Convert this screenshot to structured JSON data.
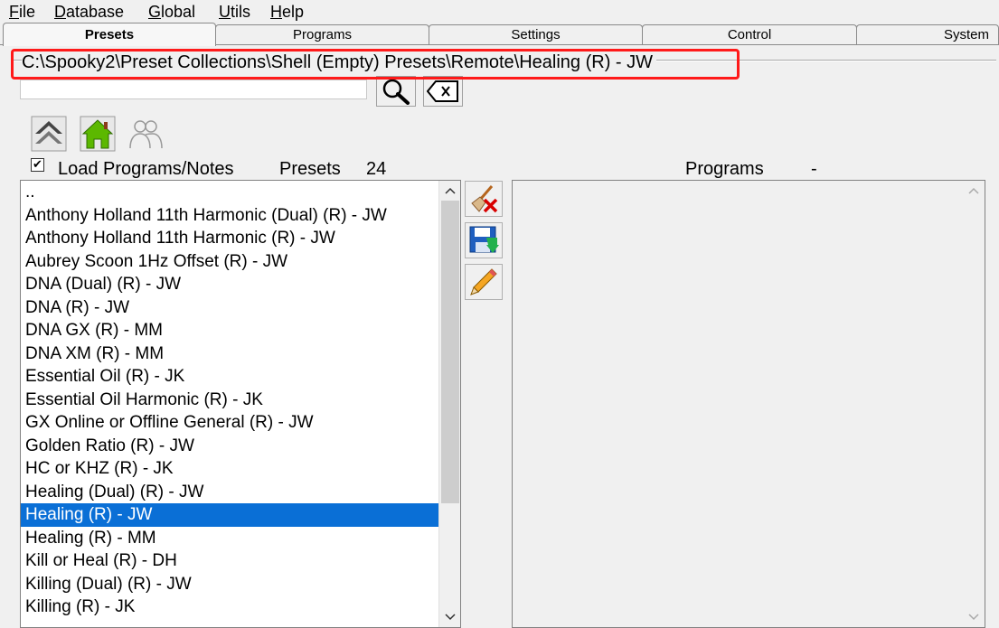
{
  "menu": {
    "file": {
      "key": "F",
      "rest": "ile"
    },
    "database": {
      "key": "D",
      "rest": "atabase"
    },
    "global": {
      "key": "G",
      "rest": "lobal"
    },
    "utils": {
      "key": "U",
      "rest": "tils"
    },
    "help": {
      "key": "H",
      "rest": "elp"
    }
  },
  "tabs": [
    {
      "label": "Presets",
      "active": true
    },
    {
      "label": "Programs"
    },
    {
      "label": "Settings"
    },
    {
      "label": "Control"
    },
    {
      "label": "System"
    }
  ],
  "path": "C:\\Spooky2\\Preset Collections\\Shell (Empty) Presets\\Remote\\Healing (R) - JW",
  "search": {
    "value": ""
  },
  "icons": {
    "search": "magnifier-icon",
    "clear": "clear-search-icon",
    "up": "up-folder-icon",
    "home": "home-icon",
    "users": "users-icon",
    "delete": "broom-delete-icon",
    "save": "save-icon",
    "edit": "pencil-icon"
  },
  "load_programs": {
    "label": "Load Programs/Notes",
    "checked_glyph": "✔"
  },
  "presets_header": {
    "label": "Presets",
    "count": "24"
  },
  "programs_header": {
    "label": "Programs",
    "value": "-"
  },
  "presets": [
    "..",
    "Anthony Holland 11th Harmonic (Dual) (R) - JW",
    "Anthony Holland 11th Harmonic (R) - JW",
    "Aubrey Scoon 1Hz Offset (R) - JW",
    "DNA (Dual) (R) - JW",
    "DNA (R) - JW",
    "DNA GX (R) - MM",
    "DNA XM (R) - MM",
    "Essential Oil (R) - JK",
    "Essential Oil Harmonic (R) - JK",
    "GX Online or Offline General (R) - JW",
    "Golden Ratio (R) - JW",
    "HC or KHZ (R) - JK",
    "Healing (Dual) (R) - JW",
    "Healing (R) - JW",
    "Healing (R) - MM",
    "Kill or Heal (R) - DH",
    "Killing (Dual) (R) - JW",
    "Killing (R) - JK"
  ],
  "selected_index": 14,
  "colors": {
    "selection": "#0a6fd6",
    "highlight_border": "#ff1a1a"
  }
}
